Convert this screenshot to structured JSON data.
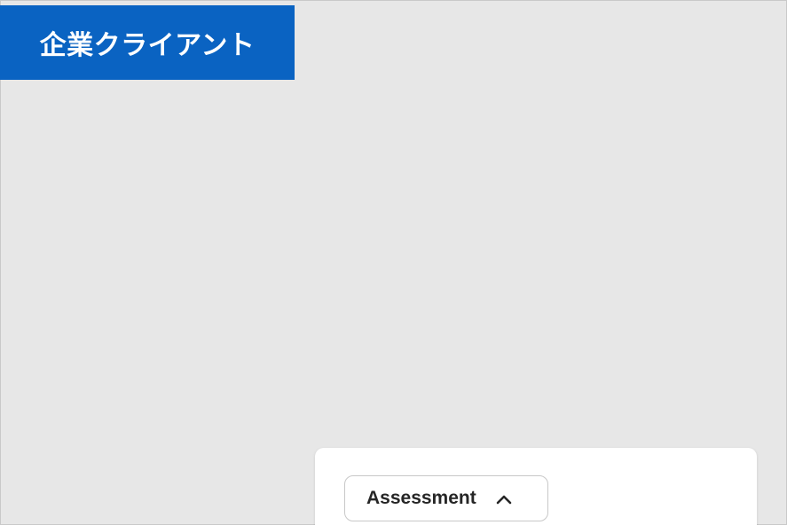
{
  "banner": {
    "label": "企業クライアント",
    "background_color": "#0a63c2",
    "text_color": "#ffffff"
  },
  "card": {
    "dropdown": {
      "label": "Assessment",
      "icon": "chevron-up-icon",
      "expanded": true
    }
  }
}
